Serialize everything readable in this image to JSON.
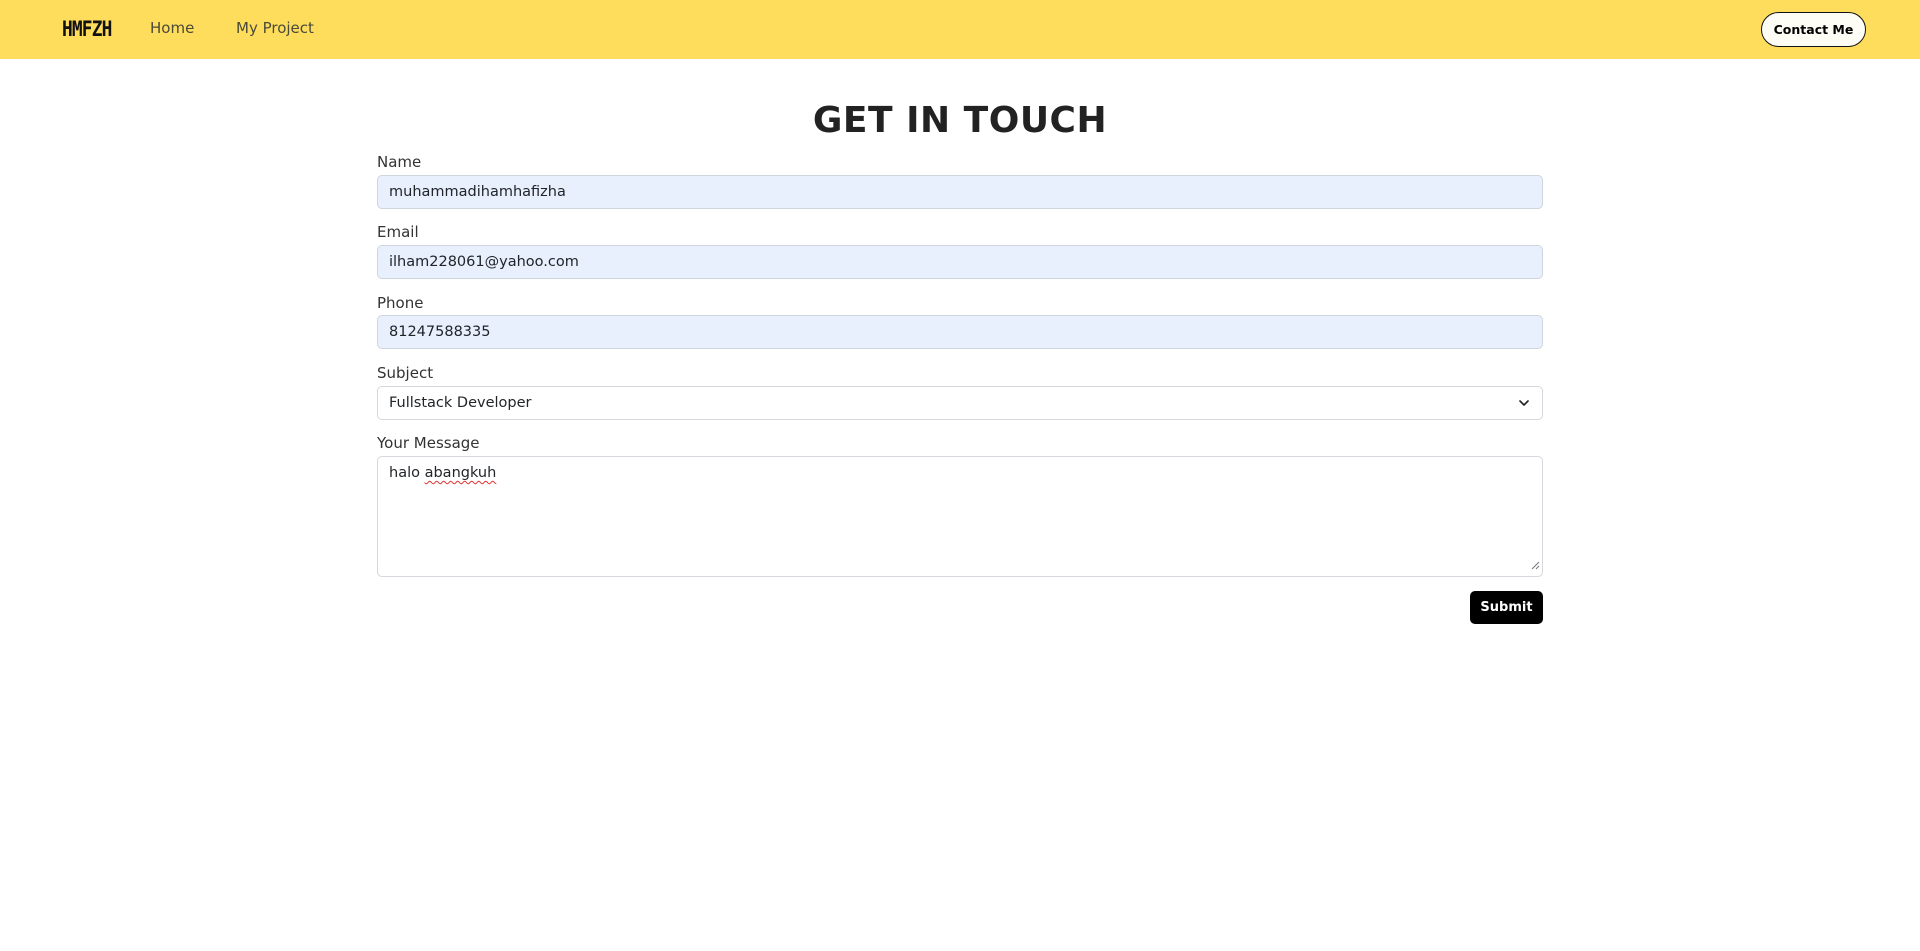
{
  "navbar": {
    "brand": "HMFZH",
    "links": [
      {
        "label": "Home"
      },
      {
        "label": "My Project"
      }
    ],
    "contact_label": "Contact Me",
    "background_color": "#ffdd5c"
  },
  "page": {
    "title": "GET IN TOUCH"
  },
  "form": {
    "name": {
      "label": "Name",
      "value": "muhammadihamhafizha"
    },
    "email": {
      "label": "Email",
      "value": "ilham228061@yahoo.com"
    },
    "phone": {
      "label": "Phone",
      "value": "81247588335"
    },
    "subject": {
      "label": "Subject",
      "selected": "Fullstack Developer",
      "icon": "chevron-down-icon"
    },
    "message": {
      "label": "Your Message",
      "word1": "halo",
      "word2": "abangkuh"
    },
    "submit_label": "Submit"
  },
  "colors": {
    "autofill_bg": "#e8f0fe",
    "submit_bg": "#000000",
    "spellcheck": "#e03131"
  }
}
